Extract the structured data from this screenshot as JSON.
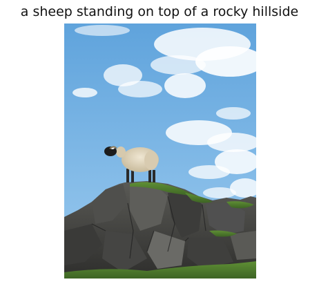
{
  "caption": "a sheep standing on top of a rocky hillside",
  "photo": {
    "subject": "sheep",
    "colors": {
      "sky_top": "#5fa3dc",
      "sky_bottom": "#9ccbef",
      "cloud": "#ffffff",
      "rock_dark": "#2b2b2b",
      "rock_mid": "#4a4a48",
      "rock_light": "#6d6d68",
      "grass": "#4e7a2c",
      "wool": "#e3d7bf",
      "sheep_face": "#1c1c1c"
    }
  }
}
